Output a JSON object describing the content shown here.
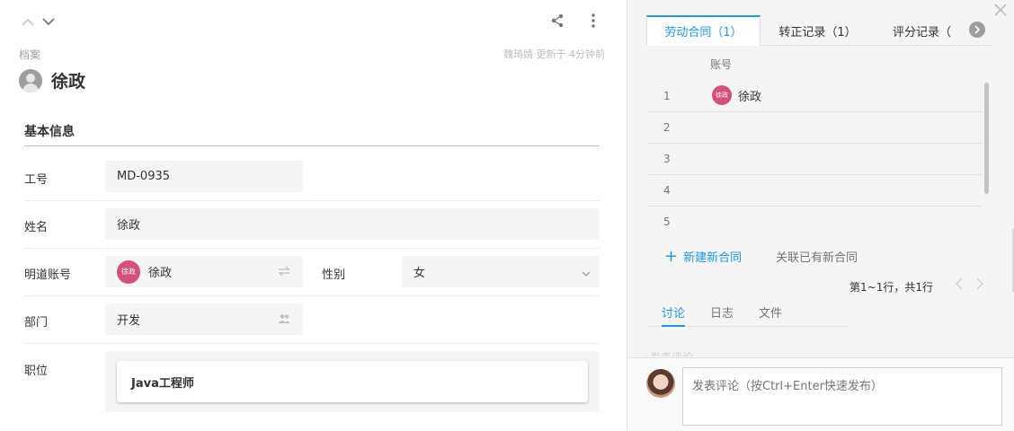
{
  "header": {
    "section": "档案",
    "updated": "魏琦婧 更新于 4分钟前",
    "title": "徐政"
  },
  "basic_info": {
    "heading": "基本信息",
    "employee_no": {
      "label": "工号",
      "value": "MD-0935"
    },
    "name": {
      "label": "姓名",
      "value": "徐政"
    },
    "account": {
      "label": "明道账号",
      "value": "徐政",
      "avatar_text": "徐政"
    },
    "gender": {
      "label": "性别",
      "value": "女"
    },
    "department": {
      "label": "部门",
      "value": "开发"
    },
    "position": {
      "label": "职位",
      "value": "Java工程师"
    }
  },
  "right_tabs": [
    {
      "label": "劳动合同（1）",
      "active": true
    },
    {
      "label": "转正记录（1）",
      "active": false
    },
    {
      "label": "评分记录（",
      "active": false
    }
  ],
  "contract_table": {
    "column": "账号",
    "rows": [
      {
        "num": "1",
        "name": "徐政",
        "avatar_text": "徐政"
      },
      {
        "num": "2",
        "name": ""
      },
      {
        "num": "3",
        "name": ""
      },
      {
        "num": "4",
        "name": ""
      },
      {
        "num": "5",
        "name": ""
      }
    ],
    "new_link": "新建新合同",
    "link_existing": "关联已有新合同",
    "pager": "第1~1行，共1行"
  },
  "discussion": {
    "tabs": [
      "讨论",
      "日志",
      "文件"
    ],
    "ghost_text": "发表评论",
    "placeholder": "发表评论（按Ctrl+Enter快速发布）"
  },
  "colors": {
    "accent": "#2196f3",
    "avatar_pink": "#d24f7e"
  }
}
